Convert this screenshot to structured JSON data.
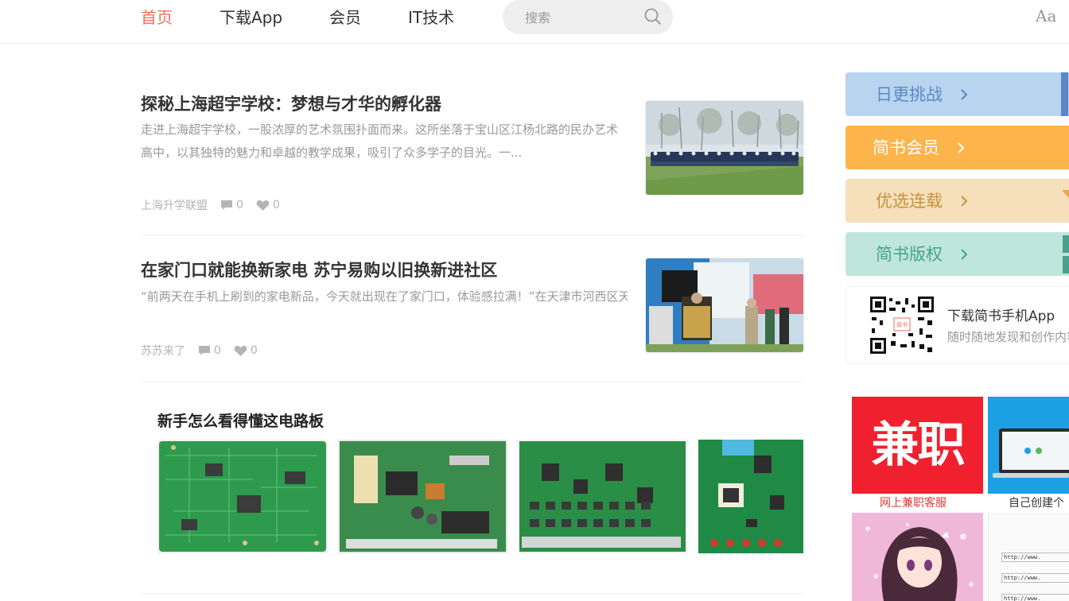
{
  "nav": {
    "items": [
      {
        "label": "首页",
        "active": true
      },
      {
        "label": "下载App",
        "active": false
      },
      {
        "label": "会员",
        "active": false
      },
      {
        "label": "IT技术",
        "active": false
      }
    ],
    "search_placeholder": "搜索",
    "font_toggle": "Aa"
  },
  "articles": [
    {
      "title": "探秘上海超宇学校：梦想与才华的孵化器",
      "abstract": "走进上海超宇学校，一股浓厚的艺术氛围扑面而来。这所坐落于宝山区江杨北路的民办艺术高中，以其独特的魅力和卓越的教学成果，吸引了众多学子的目光。一...",
      "author": "上海升学联盟",
      "comments": "0",
      "likes": "0",
      "thumb_icon": "students-assembly-photo"
    },
    {
      "title": "在家门口就能换新家电 苏宁易购以旧换新进社区",
      "abstract": "“前两天在手机上刷到的家电新品，今天就出现在了家门口，体验感拉满！”在天津市河西区天涛园社区，张女士乐呵呵地分享她看中的一款海尔新品空调，“换...",
      "author": "苏苏来了",
      "comments": "0",
      "likes": "0",
      "thumb_icon": "community-event-photo"
    }
  ],
  "collection": {
    "title": "新手怎么看得懂这电路板",
    "images": [
      "circuit-board-photo-1",
      "circuit-board-photo-2",
      "circuit-board-photo-3",
      "circuit-board-photo-4"
    ]
  },
  "sidebar": {
    "buttons": [
      {
        "label": "日更挑战",
        "bg": "#b8d4ef",
        "color": "#5b88c4"
      },
      {
        "label": "简书会员",
        "bg": "#fdb44b",
        "color": "#ffffff"
      },
      {
        "label": "优选连载",
        "bg": "#f5e0bb",
        "color": "#c79237"
      },
      {
        "label": "简书版权",
        "bg": "#bfe6dc",
        "color": "#46a28a"
      }
    ],
    "app": {
      "title": "下载简书手机App",
      "subtitle": "随时随地发现和创作内容",
      "qr_label": "简书"
    },
    "ads": [
      {
        "text": "兼职",
        "caption": "网上兼职客服"
      },
      {
        "text": "",
        "caption": "自己创建个"
      },
      {
        "text": "",
        "caption": ""
      },
      {
        "text": "",
        "caption": ""
      }
    ],
    "ad_url_lines": [
      "http://www.",
      "http://www.",
      "http://www."
    ]
  },
  "colors": {
    "accent": "#ea6f5a",
    "meta": "#b4b4b4",
    "abstract": "#999999"
  }
}
